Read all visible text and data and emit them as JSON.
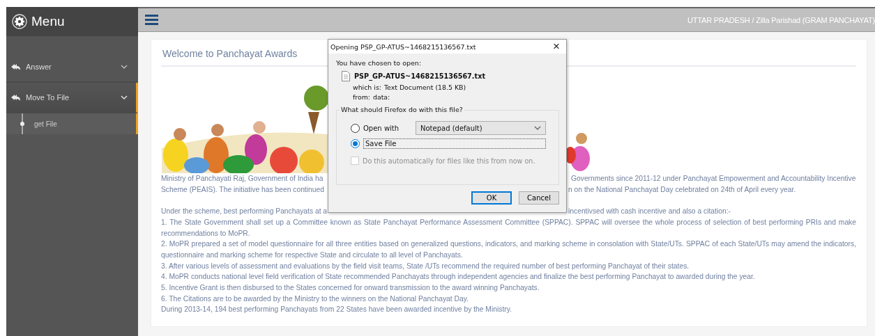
{
  "sidebar": {
    "title": "Menu",
    "items": [
      {
        "label": "Answer",
        "selected": false,
        "expanded": false
      },
      {
        "label": "Move To File",
        "selected": true,
        "expanded": true,
        "children": [
          {
            "label": "get File"
          }
        ]
      }
    ]
  },
  "topbar": {
    "breadcrumb": "UTTAR PRADESH / Zilla Parishad (GRAM PANCHAYAT)"
  },
  "content": {
    "title": "Welcome to Panchayat Awards",
    "partial_lines": [
      {
        "left": "Ministry of Panchayati Raj, Government of India ha",
        "right": "Governments since 2011-12 under Panchayat Empowerment and Accountability Incentive"
      },
      {
        "left": "Scheme (PEAIS). The initiative has been continued",
        "right": "n on the National Panchayat Day celebrated on 24th of April every year."
      },
      {
        "left": "Under the scheme, best performing Panchayats at a",
        "right": "incentivsed with cash incentive and also a citation:-"
      }
    ],
    "paragraphs": [
      "1. The State Government shall set up a Committee known as State Panchayat Performance Assessment Committee (SPPAC). SPPAC will oversee the whole process of selection of best performing PRIs and make recommendations to MoPR.",
      "2. MoPR prepared a set of model questionnaire for all three entities based on generalized questions, indicators, and marking scheme in consolation with State/UTs. SPPAC of each State/UTs may amend the indicators, questionnaire and marking scheme for respective State and circulate to all level of Panchayats.",
      "3. After various levels of assessment and evaluations by the field visit teams, State /UTs recommend the required number of best performing Panchayat of their states.",
      "4. MoPR conducts national level field verification of State recommended Panchayats through independent agencies and finalize the best performing Panchayat to awarded during the year.",
      "5. Incentive Grant is then disbursed to the States concerned for onward transmission to the award winning Panchayats.",
      "6. The Citations are to be awarded by the Ministry to the winners on the National Panchayat Day.",
      "During 2013-14, 194 best performing Panchayats from 22 States have been awarded incentive by the Ministry."
    ]
  },
  "dialog": {
    "title": "Opening PSP_GP-ATUS~1468215136567.txt",
    "close": "×",
    "intro": "You have chosen to open:",
    "file_name": "PSP_GP-ATUS~1468215136567.txt",
    "which_is_label": "which is:",
    "which_is": "Text Document (18.5 KB)",
    "from_label": "from:",
    "from": "data:",
    "group_label": "What should Firefox do with this file?",
    "options": [
      {
        "kind": "open-with",
        "label": "Open with",
        "selected": false,
        "app": "Notepad (default)"
      },
      {
        "kind": "save",
        "label": "Save File",
        "selected": true
      }
    ],
    "auto": {
      "label": "Do this automatically for files like this from now on.",
      "checked": false,
      "disabled": true
    },
    "buttons": [
      {
        "label": "OK",
        "default": true
      },
      {
        "label": "Cancel",
        "default": false
      }
    ]
  }
}
